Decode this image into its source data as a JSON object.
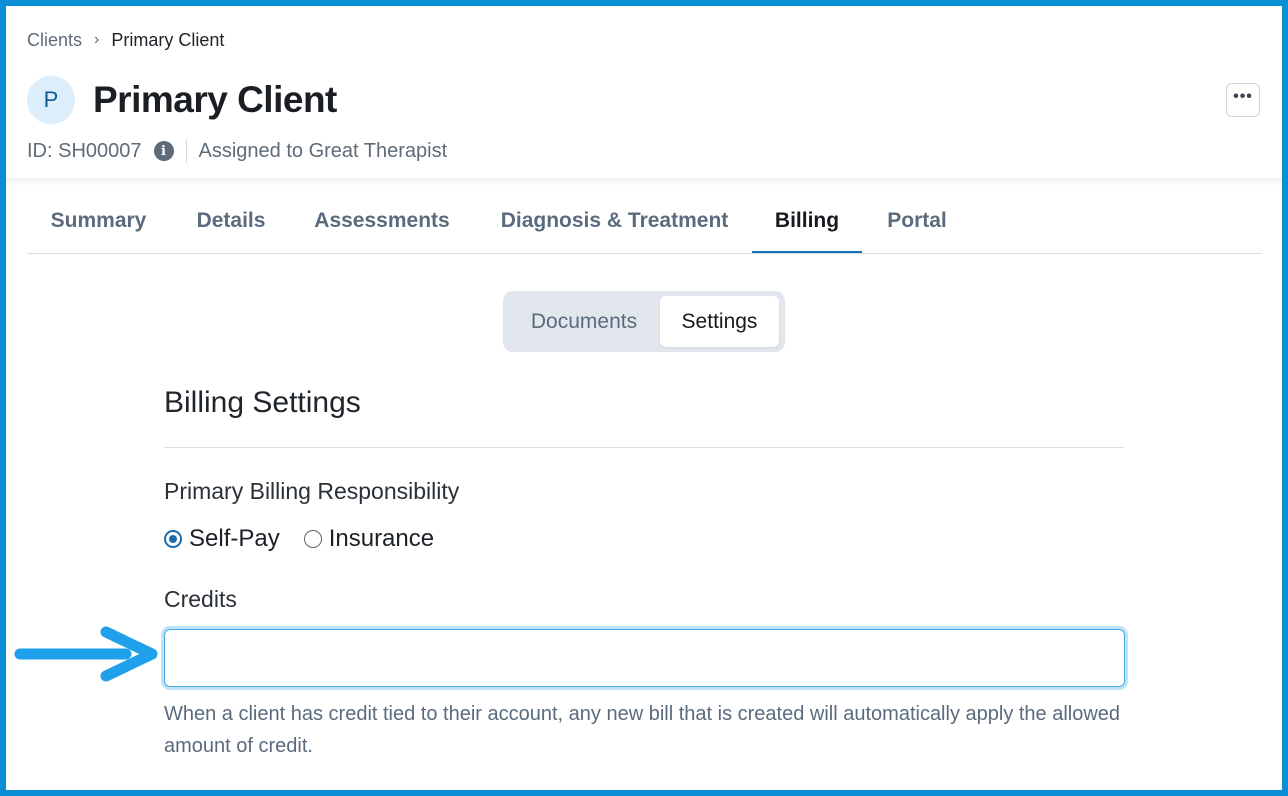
{
  "breadcrumb": {
    "parent": "Clients",
    "separator": "›",
    "current": "Primary Client"
  },
  "client": {
    "avatar_initial": "P",
    "name": "Primary Client",
    "id_text": "ID: SH00007",
    "assigned_text": "Assigned to Great Therapist"
  },
  "header": {
    "more_label": "•••"
  },
  "tabs": [
    {
      "label": "Summary"
    },
    {
      "label": "Details"
    },
    {
      "label": "Assessments"
    },
    {
      "label": "Diagnosis & Treatment"
    },
    {
      "label": "Billing",
      "active": true
    },
    {
      "label": "Portal"
    }
  ],
  "subtabs": [
    {
      "label": "Documents"
    },
    {
      "label": "Settings",
      "active": true
    }
  ],
  "billing_settings": {
    "title": "Billing Settings",
    "responsibility_label": "Primary Billing Responsibility",
    "options": [
      {
        "label": "Self-Pay",
        "selected": true
      },
      {
        "label": "Insurance",
        "selected": false
      }
    ],
    "credits_label": "Credits",
    "credits_value": "",
    "credits_help": "When a client has credit tied to their account, any new bill that is created will automatically apply the allowed amount of credit."
  },
  "colors": {
    "frame": "#0a8fd6",
    "accent": "#1570b8",
    "annotation_arrow": "#1ea0ea"
  }
}
